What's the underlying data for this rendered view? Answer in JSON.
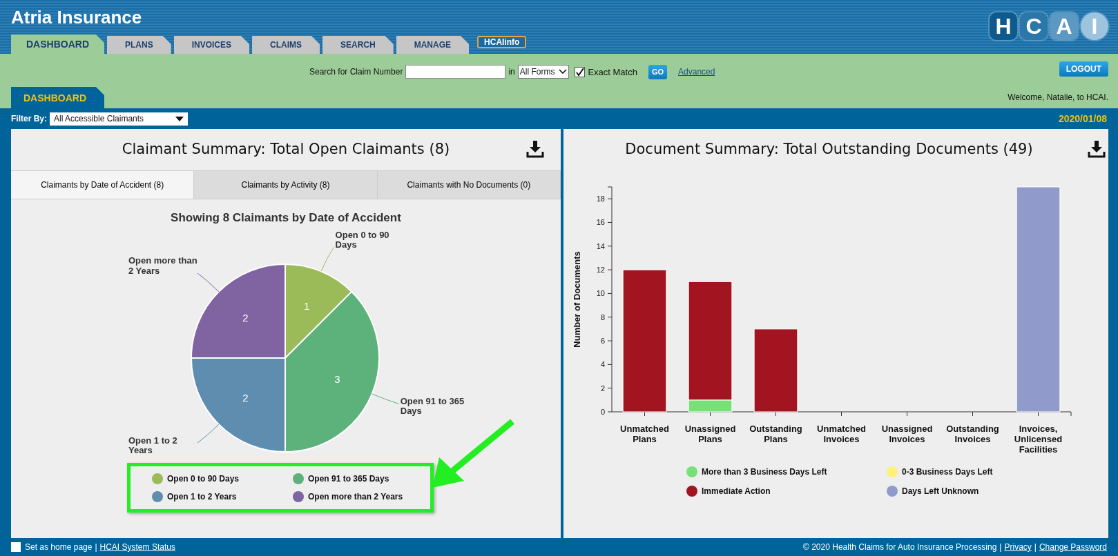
{
  "app": {
    "title": "Atria Insurance"
  },
  "logo": {
    "letters": [
      "H",
      "C",
      "A",
      "I"
    ]
  },
  "tabs": [
    {
      "label": "DASHBOARD",
      "selected": true
    },
    {
      "label": "PLANS",
      "selected": false
    },
    {
      "label": "INVOICES",
      "selected": false
    },
    {
      "label": "CLAIMS",
      "selected": false
    },
    {
      "label": "SEARCH",
      "selected": false
    },
    {
      "label": "MANAGE",
      "selected": false
    }
  ],
  "info_link": "HCAIinfo",
  "search": {
    "label": "Search for Claim Number",
    "in_label": "in",
    "scope": "All Forms",
    "exact_match": {
      "label": "Exact Match",
      "checked": true
    },
    "go": "GO",
    "advanced": "Advanced"
  },
  "logout": "LOGOUT",
  "welcome": "Welcome, Natalie, to HCAI.",
  "subtab": "DASHBOARD",
  "filter": {
    "label": "Filter By:",
    "value": "All Accessible Claimants"
  },
  "date": "2020/01/08",
  "claimant_panel": {
    "title": "Claimant Summary: Total Open Claimants (8)",
    "tabs": [
      {
        "label": "Claimants by Date of Accident (8)",
        "selected": true
      },
      {
        "label": "Claimants by Activity (8)",
        "selected": false
      },
      {
        "label": "Claimants with No Documents (0)",
        "selected": false
      }
    ],
    "chart_data": {
      "type": "pie",
      "title": "Showing 8 Claimants by Date of Accident",
      "categories": [
        "Open 0 to 90 Days",
        "Open 91 to 365 Days",
        "Open 1 to 2 Years",
        "Open more than 2 Years"
      ],
      "values": [
        1,
        3,
        2,
        2
      ],
      "data_labels": true
    },
    "legend": [
      {
        "label": "Open 0 to 90 Days",
        "color": "#9bbb59"
      },
      {
        "label": "Open 91 to 365 Days",
        "color": "#5db27c"
      },
      {
        "label": "Open 1 to 2 Years",
        "color": "#5f8db0"
      },
      {
        "label": "Open more than 2 Years",
        "color": "#8064a2"
      }
    ]
  },
  "document_panel": {
    "title": "Document Summary: Total Outstanding Documents (49)",
    "chart_data": {
      "type": "bar",
      "stacked": true,
      "ylabel": "Number of Documents",
      "legend": true,
      "categories": [
        "Unmatched Plans",
        "Unassigned Plans",
        "Outstanding Plans",
        "Unmatched Invoices",
        "Unassigned Invoices",
        "Outstanding Invoices",
        "Invoices, Unlicensed Facilities"
      ],
      "ylim": [
        0,
        19
      ],
      "yticks": [
        0,
        2,
        4,
        6,
        8,
        10,
        12,
        14,
        16,
        18
      ],
      "series": [
        {
          "name": "More than 3 Business Days Left",
          "color": "#77e077",
          "values": [
            0,
            1,
            0,
            0,
            0,
            0,
            0
          ]
        },
        {
          "name": "0-3 Business Days Left",
          "color": "#fff07a",
          "values": [
            0,
            0,
            0,
            0,
            0,
            0,
            0
          ]
        },
        {
          "name": "Immediate Action",
          "color": "#a21420",
          "values": [
            12,
            10,
            7,
            0,
            0,
            0,
            0
          ]
        },
        {
          "name": "Days Left Unknown",
          "color": "#919bcb",
          "values": [
            0,
            0,
            0,
            0,
            0,
            0,
            19
          ]
        }
      ]
    }
  },
  "footer": {
    "left": [
      {
        "kind": "checkbox",
        "text": "Set as home page",
        "checked": false
      },
      {
        "kind": "sep",
        "text": "|"
      },
      {
        "kind": "link",
        "text": "HCAI System Status"
      }
    ],
    "right": [
      {
        "kind": "text",
        "text": "© 2020 Health Claims for Auto Insurance Processing"
      },
      {
        "kind": "sep",
        "text": "|"
      },
      {
        "kind": "link",
        "text": "Privacy"
      },
      {
        "kind": "sep",
        "text": "|"
      },
      {
        "kind": "link",
        "text": "Change Password"
      }
    ]
  }
}
